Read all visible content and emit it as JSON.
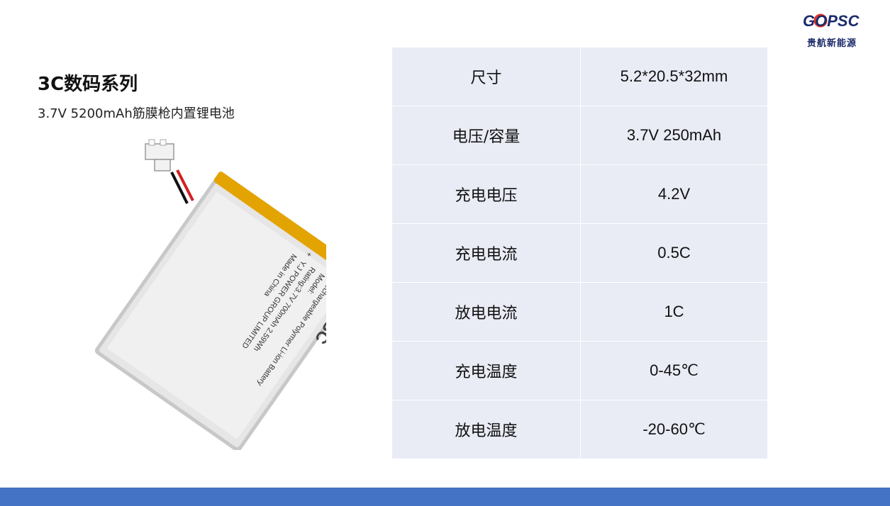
{
  "brand": {
    "logo_text": "GOPSC",
    "logo_sub": "贵航新能源",
    "primary_color": "#1b2a6b",
    "accent_color": "#e63322"
  },
  "title": "3C数码系列",
  "subtitle": "3.7V 5200mAh筋膜枪内置锂电池",
  "product_label": {
    "logo": "GOPSC",
    "lines": [
      "Rechargeable Polymer Li-ion Battery",
      "Model:",
      "Rating:3.7V 700mAh 2.59Wh",
      "Y.J POWER GROUP LIMITED",
      "Made in China"
    ],
    "minus": "-",
    "plus": "+"
  },
  "specs": [
    {
      "label": "尺寸",
      "value": "5.2*20.5*32mm"
    },
    {
      "label": "电压/容量",
      "value": "3.7V 250mAh"
    },
    {
      "label": "充电电压",
      "value": "4.2V"
    },
    {
      "label": "充电电流",
      "value": "0.5C"
    },
    {
      "label": "放电电流",
      "value": "1C"
    },
    {
      "label": "充电温度",
      "value": "0-45℃"
    },
    {
      "label": "放电温度",
      "value": "-20-60℃"
    }
  ],
  "colors": {
    "table_bg": "#e9ebf5",
    "bottom_bar": "#4472c4",
    "battery_edge": "#e3a300"
  }
}
